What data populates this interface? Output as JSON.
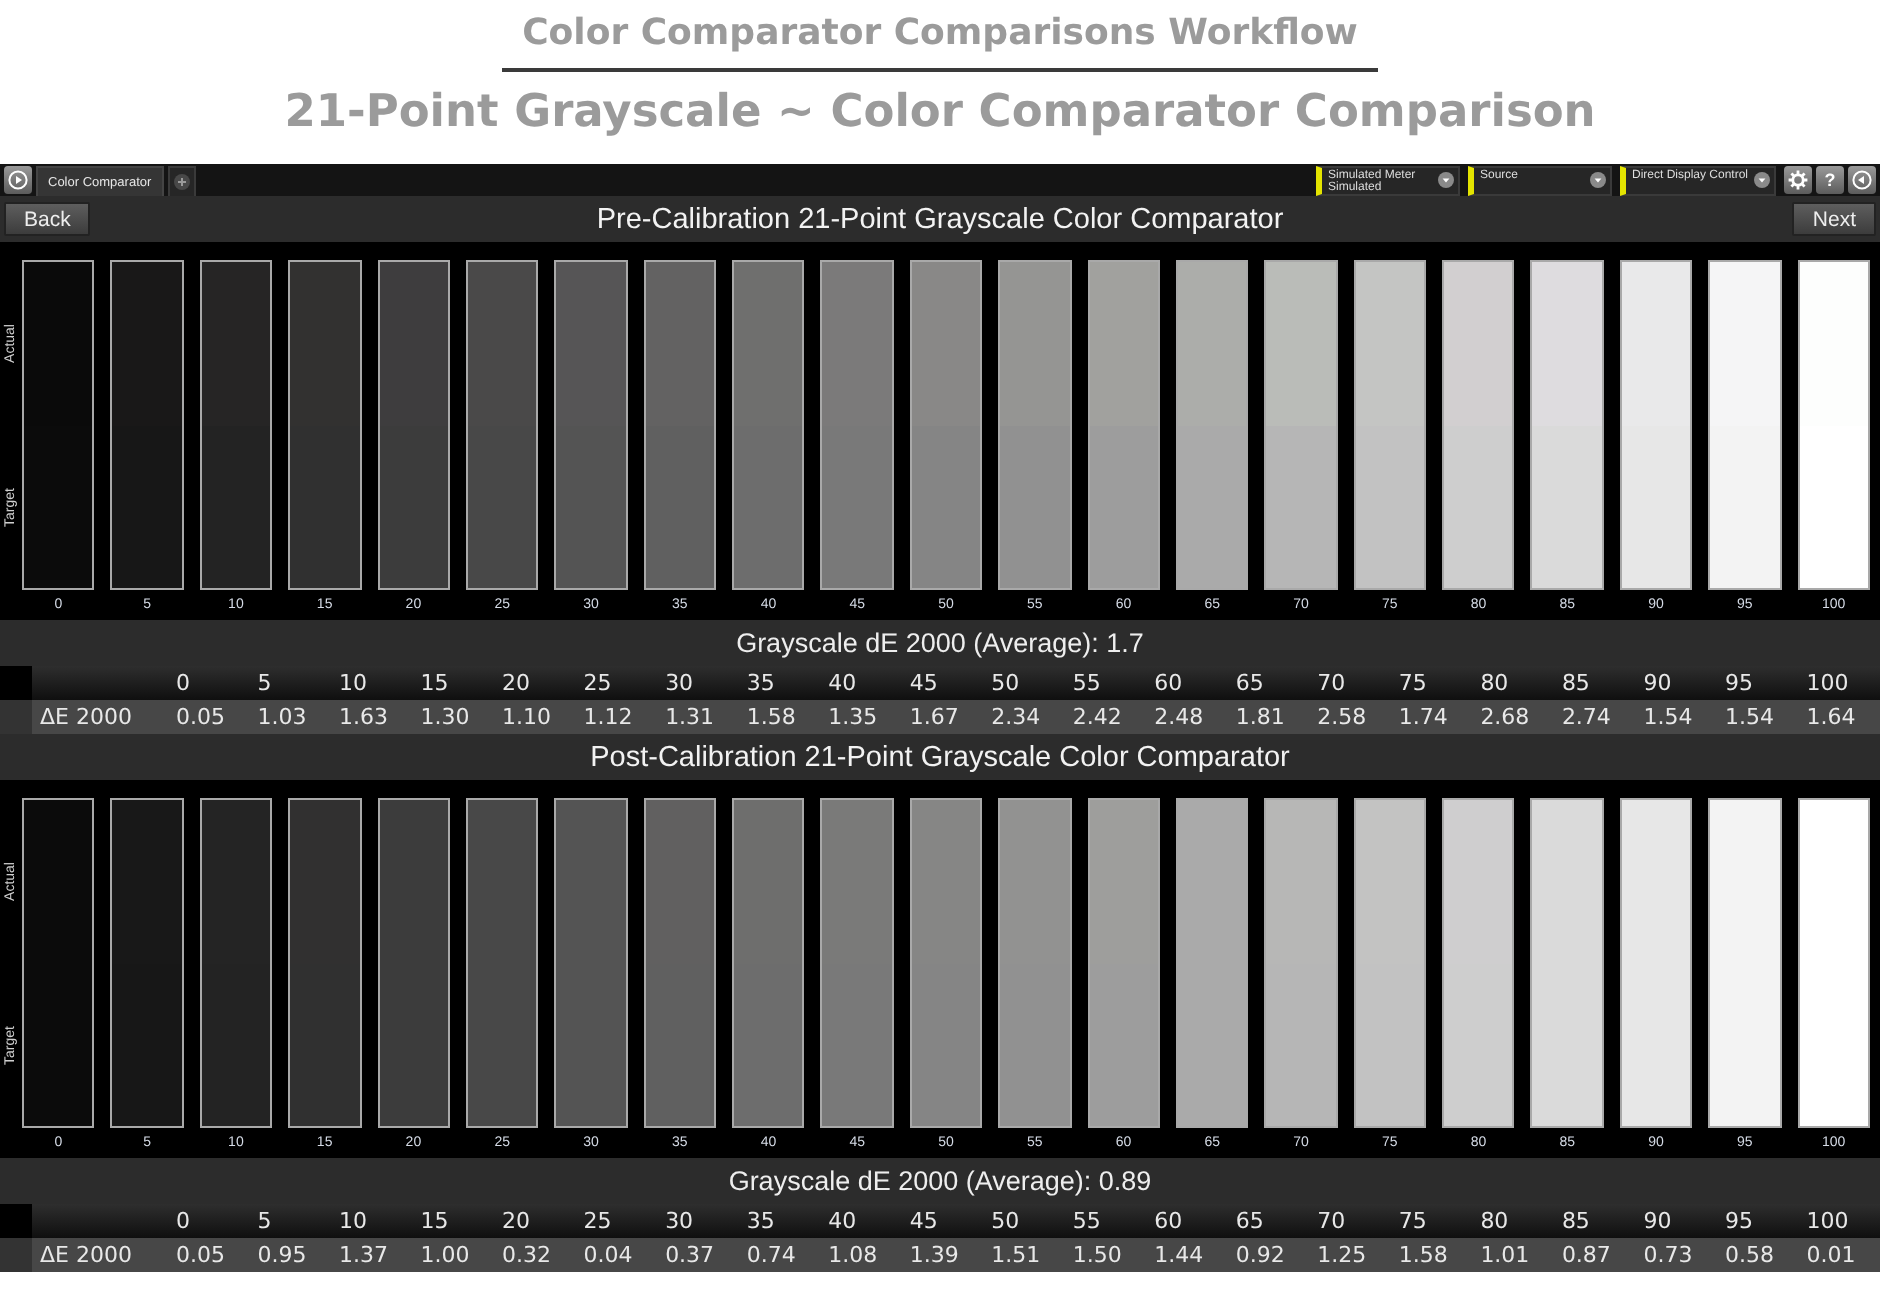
{
  "page_title": "Color Comparator Comparisons Workflow",
  "page_subtitle": "21-Point Grayscale ~ Color Comparator Comparison",
  "toolbar": {
    "tabs": [
      {
        "label": "Color Comparator",
        "selected": true
      }
    ],
    "dropdowns": [
      {
        "label": "Simulated Meter",
        "value": "Simulated"
      },
      {
        "label": "Source"
      },
      {
        "label": "Direct Display Control"
      }
    ],
    "help_label": "?"
  },
  "sections": [
    {
      "title": "Pre-Calibration 21-Point Grayscale Color Comparator",
      "nav": {
        "back": "Back",
        "next": "Next"
      },
      "row_labels": [
        "Actual",
        "Target"
      ],
      "swatches": [
        {
          "label": "0",
          "actual": {
            "color": "#0a0a0a"
          },
          "target": {
            "color": "#0b0b0b"
          }
        },
        {
          "label": "5",
          "actual": {
            "color": "#191818"
          },
          "target": {
            "color": "#171717"
          }
        },
        {
          "label": "10",
          "actual": {
            "color": "#262525"
          },
          "target": {
            "color": "#232323"
          }
        },
        {
          "label": "15",
          "actual": {
            "color": "#323130"
          },
          "target": {
            "color": "#303030"
          }
        },
        {
          "label": "20",
          "actual": {
            "color": "#3e3d3e"
          },
          "target": {
            "color": "#3c3c3c"
          }
        },
        {
          "label": "25",
          "actual": {
            "color": "#4a4949"
          },
          "target": {
            "color": "#484848"
          }
        },
        {
          "label": "30",
          "actual": {
            "color": "#565556"
          },
          "target": {
            "color": "#545454"
          }
        },
        {
          "label": "35",
          "actual": {
            "color": "#636262"
          },
          "target": {
            "color": "#606060"
          }
        },
        {
          "label": "40",
          "actual": {
            "color": "#6f6f6e"
          },
          "target": {
            "color": "#6d6d6d"
          }
        },
        {
          "label": "45",
          "actual": {
            "color": "#7b7a7a"
          },
          "target": {
            "color": "#797979"
          }
        },
        {
          "label": "50",
          "actual": {
            "color": "#898887"
          },
          "target": {
            "color": "#858585"
          }
        },
        {
          "label": "55",
          "actual": {
            "color": "#959593"
          },
          "target": {
            "color": "#919191"
          }
        },
        {
          "label": "60",
          "actual": {
            "color": "#a1a19e"
          },
          "target": {
            "color": "#9d9d9d"
          }
        },
        {
          "label": "65",
          "actual": {
            "color": "#acadaa"
          },
          "target": {
            "color": "#aaaaaa"
          }
        },
        {
          "label": "70",
          "actual": {
            "color": "#babcb8"
          },
          "target": {
            "color": "#b6b6b6"
          }
        },
        {
          "label": "75",
          "actual": {
            "color": "#c4c5c3"
          },
          "target": {
            "color": "#c2c2c2"
          }
        },
        {
          "label": "80",
          "actual": {
            "color": "#d2cfd0"
          },
          "target": {
            "color": "#cecece"
          }
        },
        {
          "label": "85",
          "actual": {
            "color": "#dedcdf"
          },
          "target": {
            "color": "#dadada"
          }
        },
        {
          "label": "90",
          "actual": {
            "color": "#e9e9ea"
          },
          "target": {
            "color": "#e7e7e7"
          }
        },
        {
          "label": "95",
          "actual": {
            "color": "#f5f5f6"
          },
          "target": {
            "color": "#f3f3f3"
          }
        },
        {
          "label": "100",
          "actual": {
            "color": "#fdfefd"
          },
          "target": {
            "color": "#ffffff"
          }
        }
      ],
      "average": "Grayscale dE 2000 (Average): 1.7",
      "table": {
        "columns": [
          "0",
          "5",
          "10",
          "15",
          "20",
          "25",
          "30",
          "35",
          "40",
          "45",
          "50",
          "55",
          "60",
          "65",
          "70",
          "75",
          "80",
          "85",
          "90",
          "95",
          "100"
        ],
        "rows": [
          {
            "label": "ΔE 2000",
            "values": [
              "0.05",
              "1.03",
              "1.63",
              "1.30",
              "1.10",
              "1.12",
              "1.31",
              "1.58",
              "1.35",
              "1.67",
              "2.34",
              "2.42",
              "2.48",
              "1.81",
              "2.58",
              "1.74",
              "2.68",
              "2.74",
              "1.54",
              "1.54",
              "1.64"
            ]
          }
        ]
      }
    },
    {
      "title": "Post-Calibration 21-Point Grayscale Color Comparator",
      "row_labels": [
        "Actual",
        "Target"
      ],
      "swatches": [
        {
          "label": "0",
          "actual": {
            "color": "#0b0b0b"
          },
          "target": {
            "color": "#0b0b0b"
          }
        },
        {
          "label": "5",
          "actual": {
            "color": "#181818"
          },
          "target": {
            "color": "#171717"
          }
        },
        {
          "label": "10",
          "actual": {
            "color": "#242424"
          },
          "target": {
            "color": "#232323"
          }
        },
        {
          "label": "15",
          "actual": {
            "color": "#313030"
          },
          "target": {
            "color": "#303030"
          }
        },
        {
          "label": "20",
          "actual": {
            "color": "#3c3c3c"
          },
          "target": {
            "color": "#3c3c3c"
          }
        },
        {
          "label": "25",
          "actual": {
            "color": "#484848"
          },
          "target": {
            "color": "#484848"
          }
        },
        {
          "label": "30",
          "actual": {
            "color": "#545454"
          },
          "target": {
            "color": "#545454"
          }
        },
        {
          "label": "35",
          "actual": {
            "color": "#616060"
          },
          "target": {
            "color": "#606060"
          }
        },
        {
          "label": "40",
          "actual": {
            "color": "#6e6e6d"
          },
          "target": {
            "color": "#6d6d6d"
          }
        },
        {
          "label": "45",
          "actual": {
            "color": "#7a7a79"
          },
          "target": {
            "color": "#797979"
          }
        },
        {
          "label": "50",
          "actual": {
            "color": "#868685"
          },
          "target": {
            "color": "#858585"
          }
        },
        {
          "label": "55",
          "actual": {
            "color": "#929291"
          },
          "target": {
            "color": "#919191"
          }
        },
        {
          "label": "60",
          "actual": {
            "color": "#9e9e9c"
          },
          "target": {
            "color": "#9d9d9d"
          }
        },
        {
          "label": "65",
          "actual": {
            "color": "#aaaaaa"
          },
          "target": {
            "color": "#aaaaaa"
          }
        },
        {
          "label": "70",
          "actual": {
            "color": "#b7b7b6"
          },
          "target": {
            "color": "#b6b6b6"
          }
        },
        {
          "label": "75",
          "actual": {
            "color": "#c3c3c2"
          },
          "target": {
            "color": "#c2c2c2"
          }
        },
        {
          "label": "80",
          "actual": {
            "color": "#cfcecf"
          },
          "target": {
            "color": "#cecece"
          }
        },
        {
          "label": "85",
          "actual": {
            "color": "#dadada"
          },
          "target": {
            "color": "#dadada"
          }
        },
        {
          "label": "90",
          "actual": {
            "color": "#e7e7e7"
          },
          "target": {
            "color": "#e7e7e7"
          }
        },
        {
          "label": "95",
          "actual": {
            "color": "#f3f3f3"
          },
          "target": {
            "color": "#f3f3f3"
          }
        },
        {
          "label": "100",
          "actual": {
            "color": "#ffffff"
          },
          "target": {
            "color": "#ffffff"
          }
        }
      ],
      "average": "Grayscale dE 2000 (Average): 0.89",
      "table": {
        "columns": [
          "0",
          "5",
          "10",
          "15",
          "20",
          "25",
          "30",
          "35",
          "40",
          "45",
          "50",
          "55",
          "60",
          "65",
          "70",
          "75",
          "80",
          "85",
          "90",
          "95",
          "100"
        ],
        "rows": [
          {
            "label": "ΔE 2000",
            "values": [
              "0.05",
              "0.95",
              "1.37",
              "1.00",
              "0.32",
              "0.04",
              "0.37",
              "0.74",
              "1.08",
              "1.39",
              "1.51",
              "1.50",
              "1.44",
              "0.92",
              "1.25",
              "1.58",
              "1.01",
              "0.87",
              "0.73",
              "0.58",
              "0.01"
            ]
          }
        ]
      }
    }
  ]
}
